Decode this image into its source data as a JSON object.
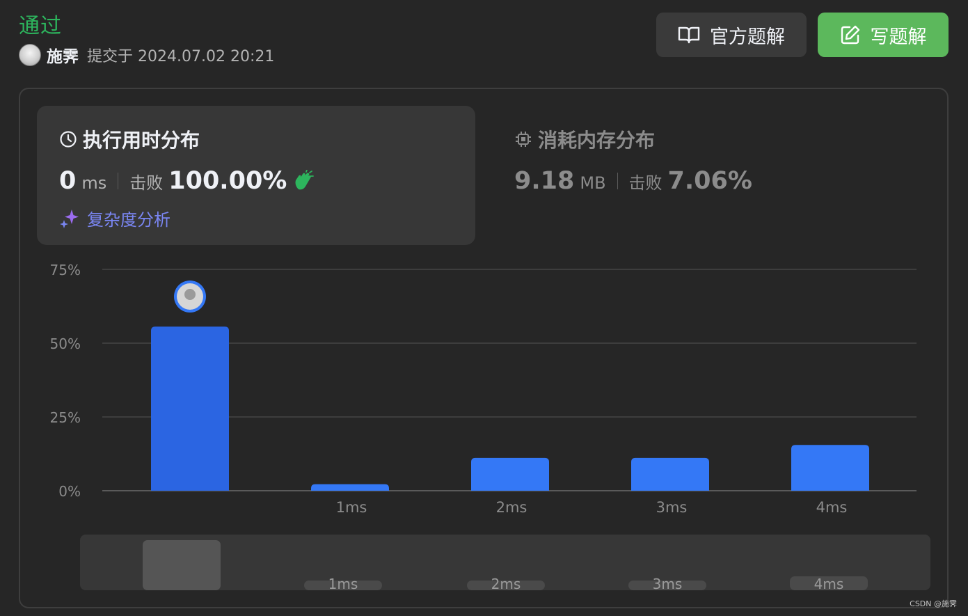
{
  "header": {
    "status": "通过",
    "user_name": "施霁",
    "submit_text": "提交于 2024.07.02 20:21",
    "official_solution_label": "官方题解",
    "write_solution_label": "写题解"
  },
  "runtime": {
    "title": "执行用时分布",
    "value": "0",
    "unit": "ms",
    "beat_label": "击败",
    "beat_percent": "100.00%",
    "analysis_label": "复杂度分析"
  },
  "memory": {
    "title": "消耗内存分布",
    "value": "9.18",
    "unit": "MB",
    "beat_label": "击败",
    "beat_percent": "7.06%"
  },
  "colors": {
    "accent_green": "#2db55d",
    "button_green": "#5cb85c",
    "bar_blue": "#3478f6",
    "bar_blue_selected": "#2b65e2",
    "analysis_purple": "#7a86f2"
  },
  "chart_data": {
    "type": "bar",
    "categories": [
      "0ms",
      "1ms",
      "2ms",
      "3ms",
      "4ms"
    ],
    "tick_labels": [
      "",
      "1ms",
      "2ms",
      "3ms",
      "4ms"
    ],
    "values": [
      55.6,
      2.2,
      11.1,
      11.1,
      15.5
    ],
    "ylim": [
      0,
      75
    ],
    "yticks": [
      "0%",
      "25%",
      "50%",
      "75%"
    ],
    "ytick_values": [
      0,
      25,
      50,
      75
    ],
    "selected_index": 0,
    "grid": true,
    "overview_labels": [
      "",
      "1ms",
      "2ms",
      "3ms",
      "4ms"
    ]
  },
  "watermark": "CSDN @施霁"
}
